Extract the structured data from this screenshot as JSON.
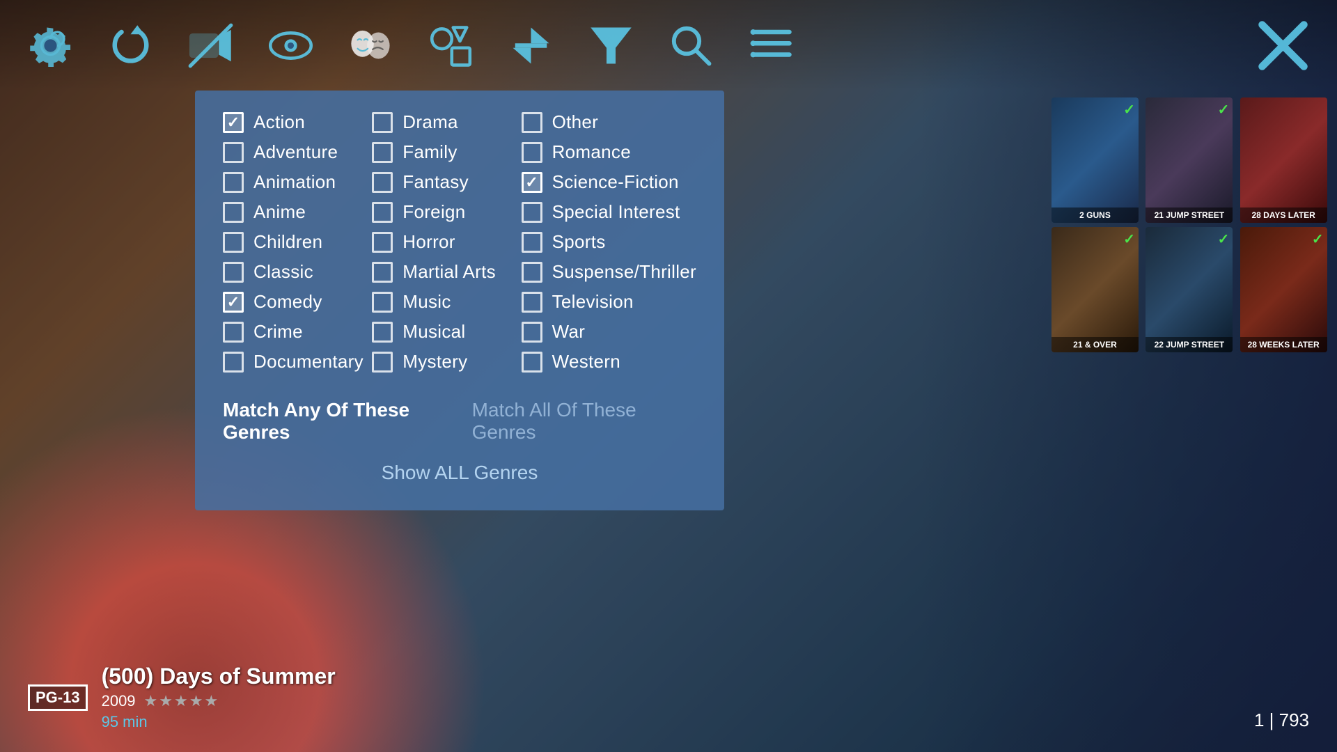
{
  "toolbar": {
    "icons": [
      "gear",
      "refresh",
      "video-slash",
      "eye",
      "theater-masks",
      "shapes",
      "filter-arrow",
      "funnel",
      "search",
      "list",
      "close"
    ]
  },
  "genre_panel": {
    "genres_col1": [
      {
        "label": "Action",
        "checked": true
      },
      {
        "label": "Adventure",
        "checked": false
      },
      {
        "label": "Animation",
        "checked": false
      },
      {
        "label": "Anime",
        "checked": false
      },
      {
        "label": "Children",
        "checked": false
      },
      {
        "label": "Classic",
        "checked": false
      },
      {
        "label": "Comedy",
        "checked": true
      },
      {
        "label": "Crime",
        "checked": false
      },
      {
        "label": "Documentary",
        "checked": false
      }
    ],
    "genres_col2": [
      {
        "label": "Drama",
        "checked": false
      },
      {
        "label": "Family",
        "checked": false
      },
      {
        "label": "Fantasy",
        "checked": false
      },
      {
        "label": "Foreign",
        "checked": false
      },
      {
        "label": "Horror",
        "checked": false
      },
      {
        "label": "Martial Arts",
        "checked": false
      },
      {
        "label": "Music",
        "checked": false
      },
      {
        "label": "Musical",
        "checked": false
      },
      {
        "label": "Mystery",
        "checked": false
      }
    ],
    "genres_col3": [
      {
        "label": "Other",
        "checked": false
      },
      {
        "label": "Romance",
        "checked": false
      },
      {
        "label": "Science-Fiction",
        "checked": true
      },
      {
        "label": "Special Interest",
        "checked": false
      },
      {
        "label": "Sports",
        "checked": false
      },
      {
        "label": "Suspense/Thriller",
        "checked": false
      },
      {
        "label": "Television",
        "checked": false
      },
      {
        "label": "War",
        "checked": false
      },
      {
        "label": "Western",
        "checked": false
      }
    ],
    "match_any_label": "Match Any Of These Genres",
    "match_all_label": "Match All Of These Genres",
    "show_all_label": "Show ALL Genres"
  },
  "movie_cards": [
    {
      "title": "2 GUNS",
      "style": "2guns",
      "checked": true
    },
    {
      "title": "21 JUMP STREET",
      "style": "21jump",
      "checked": true
    },
    {
      "title": "28 DAYS LATER",
      "style": "28days",
      "checked": false
    },
    {
      "title": "21 & OVER",
      "style": "21over",
      "checked": true
    },
    {
      "title": "22 JUMP STREET",
      "style": "22jump",
      "checked": true
    },
    {
      "title": "28 WEEKS LATER",
      "style": "28weeks",
      "checked": true
    }
  ],
  "bottom": {
    "rating": "PG-13",
    "title": "(500) Days of Summer",
    "year": "2009",
    "runtime": "95 min",
    "page": "1 | 793"
  }
}
